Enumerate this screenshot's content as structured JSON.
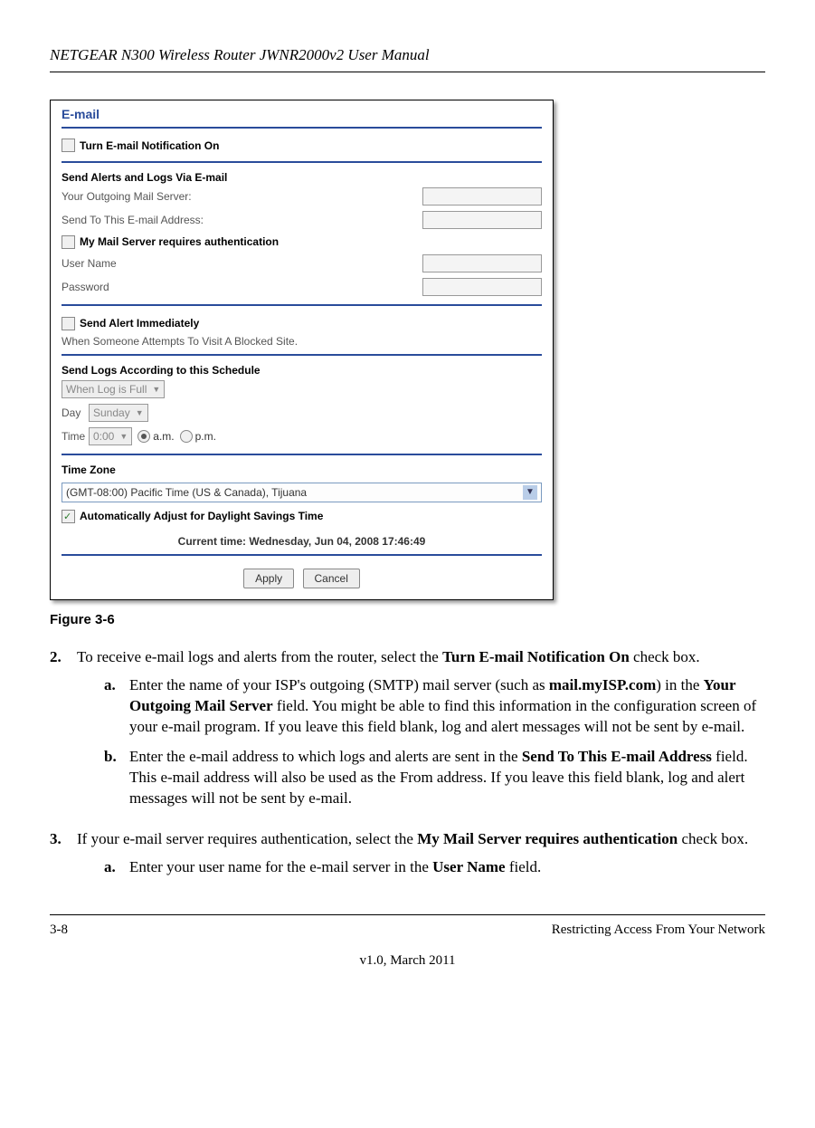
{
  "header": {
    "title": "NETGEAR N300 Wireless Router JWNR2000v2 User Manual"
  },
  "screenshot": {
    "title": "E-mail",
    "notify_label": "Turn E-mail Notification On",
    "send_section": "Send Alerts and Logs Via E-mail",
    "outgoing_label": "Your Outgoing Mail Server:",
    "sendto_label": "Send To This E-mail Address:",
    "auth_label": "My Mail Server requires authentication",
    "username_label": "User Name",
    "password_label": "Password",
    "alert_immediate_label": "Send Alert Immediately",
    "alert_desc": "When Someone Attempts To Visit A Blocked Site.",
    "schedule_section": "Send Logs According to this Schedule",
    "schedule_value": "When Log is Full",
    "day_label": "Day",
    "day_value": "Sunday",
    "time_label": "Time",
    "time_value": "0:00",
    "am": "a.m.",
    "pm": "p.m.",
    "tz_section": "Time Zone",
    "tz_value": "(GMT-08:00) Pacific Time (US & Canada), Tijuana",
    "dst_label": "Automatically Adjust for Daylight Savings Time",
    "current_time": "Current time: Wednesday, Jun 04, 2008 17:46:49",
    "apply": "Apply",
    "cancel": "Cancel"
  },
  "figure_caption": "Figure 3-6",
  "steps": {
    "s2_num": "2.",
    "s2_a": "To receive e-mail logs and alerts from the router, select the ",
    "s2_bold": "Turn E-mail Notification On",
    "s2_b": " check box.",
    "s2a_num": "a.",
    "s2a_a": "Enter the name of your ISP's outgoing (SMTP) mail server (such as ",
    "s2a_bold1": "mail.myISP.com",
    "s2a_b": ") in the ",
    "s2a_bold2": "Your Outgoing Mail Server",
    "s2a_c": " field. You might be able to find this information in the configuration screen of your e-mail program. If you leave this field blank, log and alert messages will not be sent by e-mail.",
    "s2b_num": "b.",
    "s2b_a": "Enter the e-mail address to which logs and alerts are sent in the ",
    "s2b_bold": "Send To This E-mail Address",
    "s2b_b": " field. This e-mail address will also be used as the From address. If you leave this field blank, log and alert messages will not be sent by e-mail.",
    "s3_num": "3.",
    "s3_a": "If your e-mail server requires authentication, select the ",
    "s3_bold": "My Mail Server requires authentication",
    "s3_b": " check box.",
    "s3a_num": "a.",
    "s3a_a": "Enter your user name for the e-mail server in the ",
    "s3a_bold": "User Name",
    "s3a_b": " field."
  },
  "footer": {
    "page": "3-8",
    "section": "Restricting Access From Your Network",
    "version": "v1.0, March 2011"
  }
}
